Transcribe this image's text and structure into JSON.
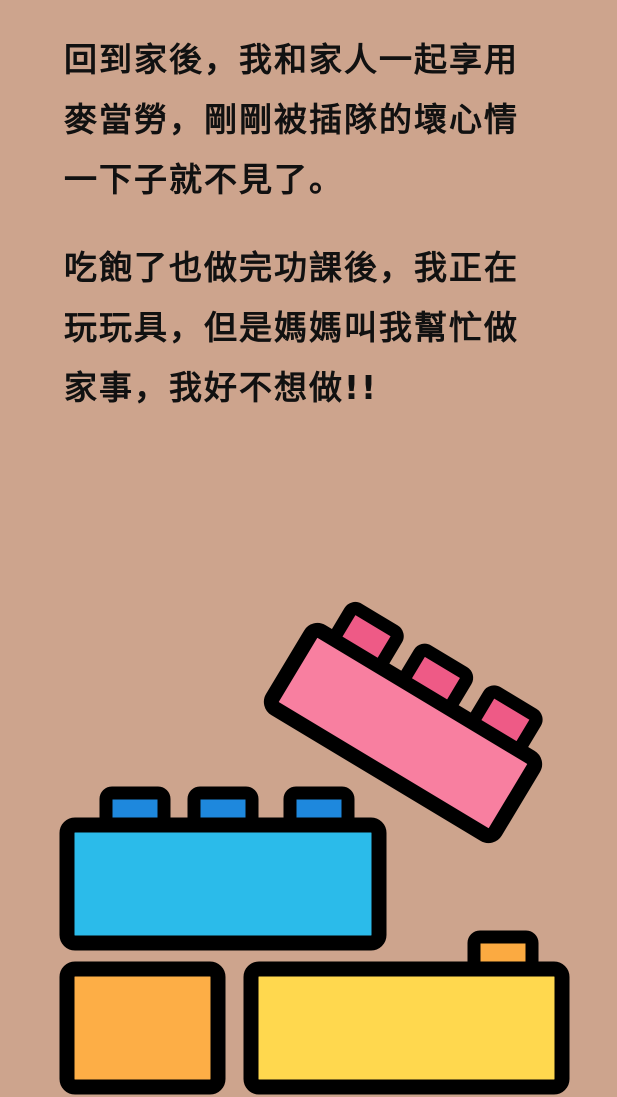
{
  "story": {
    "paragraph_1": "回到家後，我和家人一起享用\n麥當勞，剛剛被插隊的壞心情\n一下子就不見了。",
    "paragraph_2": "吃飽了也做完功課後，我正在\n玩玩具，但是媽媽叫我幫忙做\n家事，我好不想做!!"
  },
  "colors": {
    "background": "#cda48d",
    "outline": "#000000",
    "pink_block": "#f87fa0",
    "pink_stud": "#ee5a86",
    "blue_block": "#2bbbea",
    "blue_stud": "#1e88dd",
    "orange_block": "#fdae46",
    "yellow_block": "#ffd84e",
    "yellow_stud": "#fbaa41"
  },
  "icons": [
    "lego-brick-pink",
    "lego-brick-blue",
    "lego-brick-orange",
    "lego-brick-yellow"
  ]
}
